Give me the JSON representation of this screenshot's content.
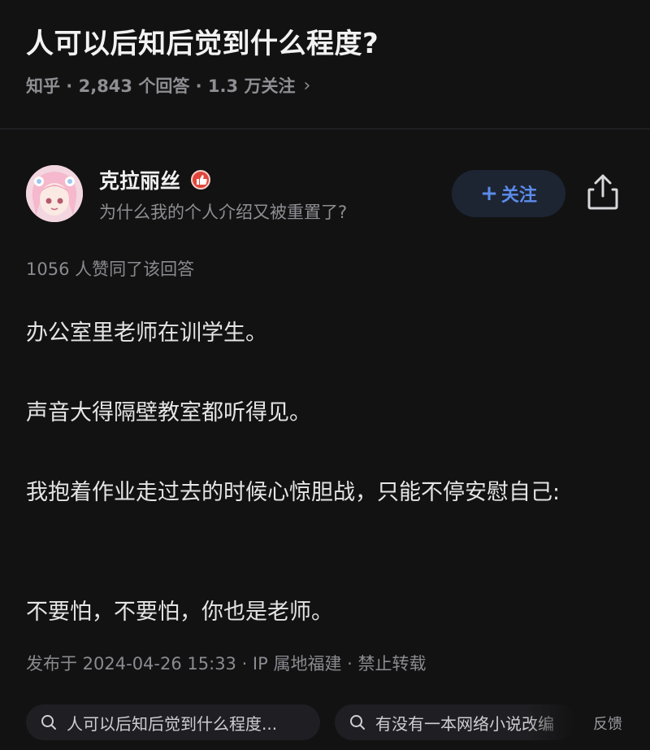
{
  "question": {
    "title": "人可以后知后觉到什么程度?",
    "meta": "知乎 · 2,843 个回答 · 1.3 万关注",
    "chevron_icon": "chevron-right-icon"
  },
  "author": {
    "name": "克拉丽丝",
    "bio": "为什么我的个人介绍又被重置了?",
    "badge_icon": "thumbs-up-badge-icon",
    "follow_label": "关注",
    "share_icon": "share-icon"
  },
  "answer": {
    "vote_line": "1056 人赞同了该回答",
    "paragraphs": [
      "办公室里老师在训学生。",
      "声音大得隔壁教室都听得见。",
      "我抱着作业走过去的时候心惊胆战，只能不停安慰自己:",
      "不要怕，不要怕，你也是老师。"
    ],
    "publish_line": "发布于 2024-04-26 15:33 · IP 属地福建 · 禁止转载"
  },
  "bottom_bar": {
    "search_chips": [
      "人可以后知后觉到什么程度...",
      "有没有一本网络小说改编"
    ],
    "feedback_label": "反馈"
  },
  "colors": {
    "background": "#121212",
    "accent": "#5b8bea",
    "badge_red": "#e0473c"
  }
}
